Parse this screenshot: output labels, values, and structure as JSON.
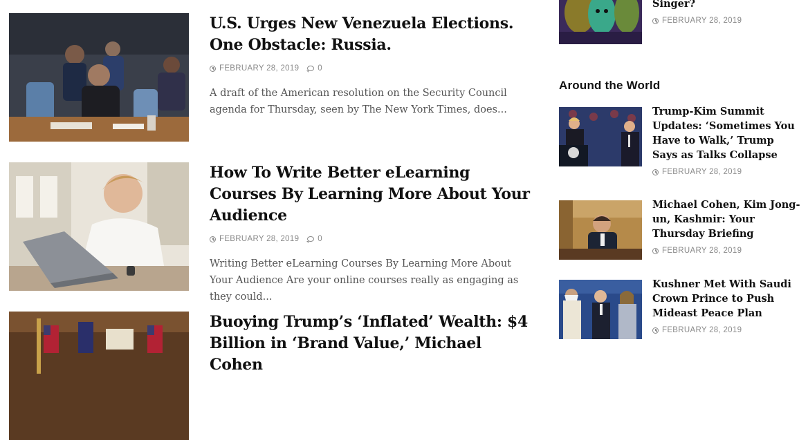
{
  "main": {
    "articles": [
      {
        "title": "U.S. Urges New Venezuela Elections. One Obstacle: Russia.",
        "date": "FEBRUARY 28, 2019",
        "comments": "0",
        "excerpt": "A draft of the American resolution on the Security Council agenda for Thursday, seen by The New York Times, does..."
      },
      {
        "title": "How To Write Better eLearning Courses By Learning More About Your Audience",
        "date": "FEBRUARY 28, 2019",
        "comments": "0",
        "excerpt": "Writing Better eLearning Courses By Learning More About Your Audience Are your online courses really as engaging as they could..."
      },
      {
        "title": "Buoying Trump’s ‘Inflated’ Wealth: $4 Billion in ‘Brand Value,’ Michael Cohen"
      }
    ]
  },
  "sidebar": {
    "top_item": {
      "title_tail": "Singer?",
      "date": "FEBRUARY 28, 2019"
    },
    "section_title": "Around the World",
    "items": [
      {
        "title": "Trump-Kim Summit Updates: ‘Sometimes You Have to Walk,’ Trump Says as Talks Collapse",
        "date": "FEBRUARY 28, 2019"
      },
      {
        "title": "Michael Cohen, Kim Jong-un, Kashmir: Your Thursday Briefing",
        "date": "FEBRUARY 28, 2019"
      },
      {
        "title": "Kushner Met With Saudi Crown Prince to Push Mideast Peace Plan",
        "date": "FEBRUARY 28, 2019"
      }
    ]
  },
  "colors": {
    "meta_gray": "#8a8a8a",
    "title_black": "#111111",
    "excerpt_gray": "#555555"
  }
}
